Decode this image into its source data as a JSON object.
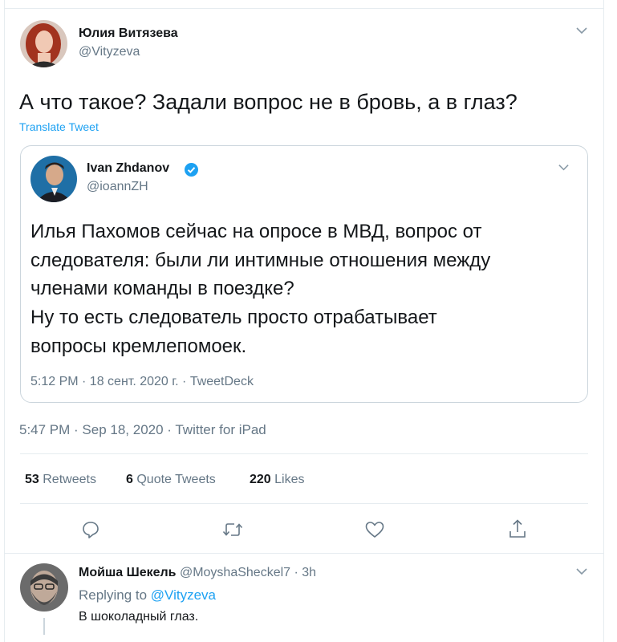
{
  "tweet": {
    "author_name": "Юлия Витязева",
    "author_handle": "@Vityzeva",
    "text": "А что такое? Задали вопрос не в бровь, а в глаз?",
    "translate_label": "Translate Tweet",
    "timestamp": "5:47 PM · Sep 18, 2020 · Twitter for iPad"
  },
  "quoted_tweet": {
    "author_name": "Ivan Zhdanov",
    "author_handle": "@ioannZH",
    "verified_icon": "verified-badge-icon",
    "lines": [
      "Илья Пахомов сейчас на опросе в МВД, вопрос от",
      "следователя: были ли интимные отношения между",
      "членами команды в поездке?",
      "Ну то есть следователь просто отрабатывает",
      "вопросы кремлепомоек."
    ],
    "timestamp": "5:12 PM · 18 сент. 2020 г. · TweetDeck"
  },
  "stats": {
    "retweets_count": "53",
    "retweets_label": "Retweets",
    "quotes_count": "6",
    "quotes_label": "Quote Tweets",
    "likes_count": "220",
    "likes_label": "Likes"
  },
  "actions": [
    "reply-icon",
    "retweet-icon",
    "like-icon",
    "share-icon"
  ],
  "reply": {
    "author_name": "Мойша Шекель",
    "author_handle": "@MoyshaSheckel7",
    "time": "· 3h",
    "replying_prefix": "Replying to",
    "replying_handle": "@Vityzeva",
    "text": "В шоколадный глаз."
  },
  "colors": {
    "accent": "#1da1f2",
    "text": "#14171a",
    "muted": "#657786",
    "border": "#e6ecf0"
  }
}
